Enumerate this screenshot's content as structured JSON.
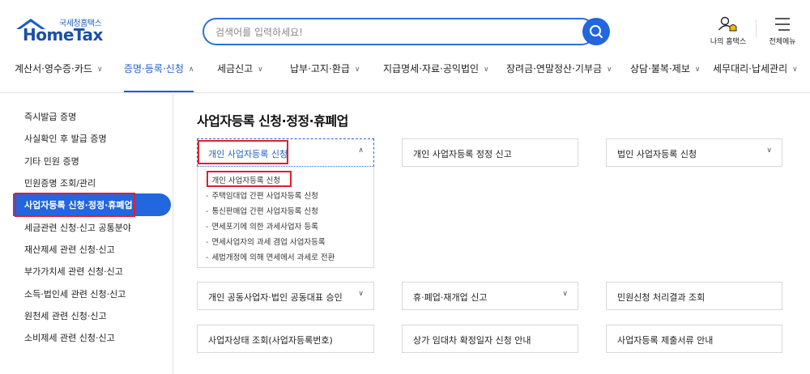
{
  "logo": {
    "sub": "국세청홈택스",
    "main": "HomeTax"
  },
  "search": {
    "placeholder": "검색어를 입력하세요!"
  },
  "util": {
    "mine_label": "나의 홈택스",
    "menu_label": "전체메뉴"
  },
  "gnb": [
    {
      "label": "계산서·영수증·카드",
      "chevron": "∨"
    },
    {
      "label": "증명·등록·신청",
      "chevron": "∧"
    },
    {
      "label": "세금신고",
      "chevron": "∨"
    },
    {
      "label": "납부·고지·환급",
      "chevron": "∨"
    },
    {
      "label": "지급명세·자료·공익법인",
      "chevron": "∨"
    },
    {
      "label": "장려금·연말정산·기부금",
      "chevron": "∨"
    },
    {
      "label": "상담·불복·제보",
      "chevron": "∨"
    },
    {
      "label": "세무대리·납세관리",
      "chevron": "∨"
    }
  ],
  "sidebar": [
    {
      "label": "즉시발급 증명"
    },
    {
      "label": "사실확인 후 발급 증명"
    },
    {
      "label": "기타 민원 증명"
    },
    {
      "label": "민원증명 조회/관리"
    },
    {
      "label": "사업자등록 신청·정정·휴폐업"
    },
    {
      "label": "세금관련 신청·신고 공통분야"
    },
    {
      "label": "재산제세 관련 신청·신고"
    },
    {
      "label": "부가가치세 관련 신청·신고"
    },
    {
      "label": "소득·법인세 관련 신청·신고"
    },
    {
      "label": "원천세 관련 신청·신고"
    },
    {
      "label": "소비제세 관련 신청·신고"
    }
  ],
  "main": {
    "title": "사업자등록 신청·정정·휴폐업",
    "cards": [
      {
        "label": "개인 사업자등록 신청",
        "chevron": "∧"
      },
      {
        "label": "개인 사업자등록 정정 신고",
        "chevron": ""
      },
      {
        "label": "법인 사업자등록 신청",
        "chevron": "∨"
      },
      {
        "label": "개인 공동사업자·법인 공동대표 승인",
        "chevron": "∨"
      },
      {
        "label": "휴·폐업·재개업 신고",
        "chevron": "∨"
      },
      {
        "label": "민원신청 처리결과 조회",
        "chevron": ""
      },
      {
        "label": "사업자상태 조회(사업자등록번호)",
        "chevron": ""
      },
      {
        "label": "상가 임대차 확정일자 신청 안내",
        "chevron": ""
      },
      {
        "label": "사업자등록 제출서류 안내",
        "chevron": ""
      }
    ],
    "submenu": [
      {
        "label": "개인 사업자등록 신청"
      },
      {
        "label": "주택임대업 간편 사업자등록 신청"
      },
      {
        "label": "통신판매업 간편 사업자등록 신청"
      },
      {
        "label": "면세포기에 의한 과세사업자 등록"
      },
      {
        "label": "면세사업자의 과세 겸업 사업자등록"
      },
      {
        "label": "세법개정에 의해 면세에서 과세로 전환"
      }
    ]
  },
  "colors": {
    "accent": "#2266e0",
    "highlight": "#e0202a"
  }
}
